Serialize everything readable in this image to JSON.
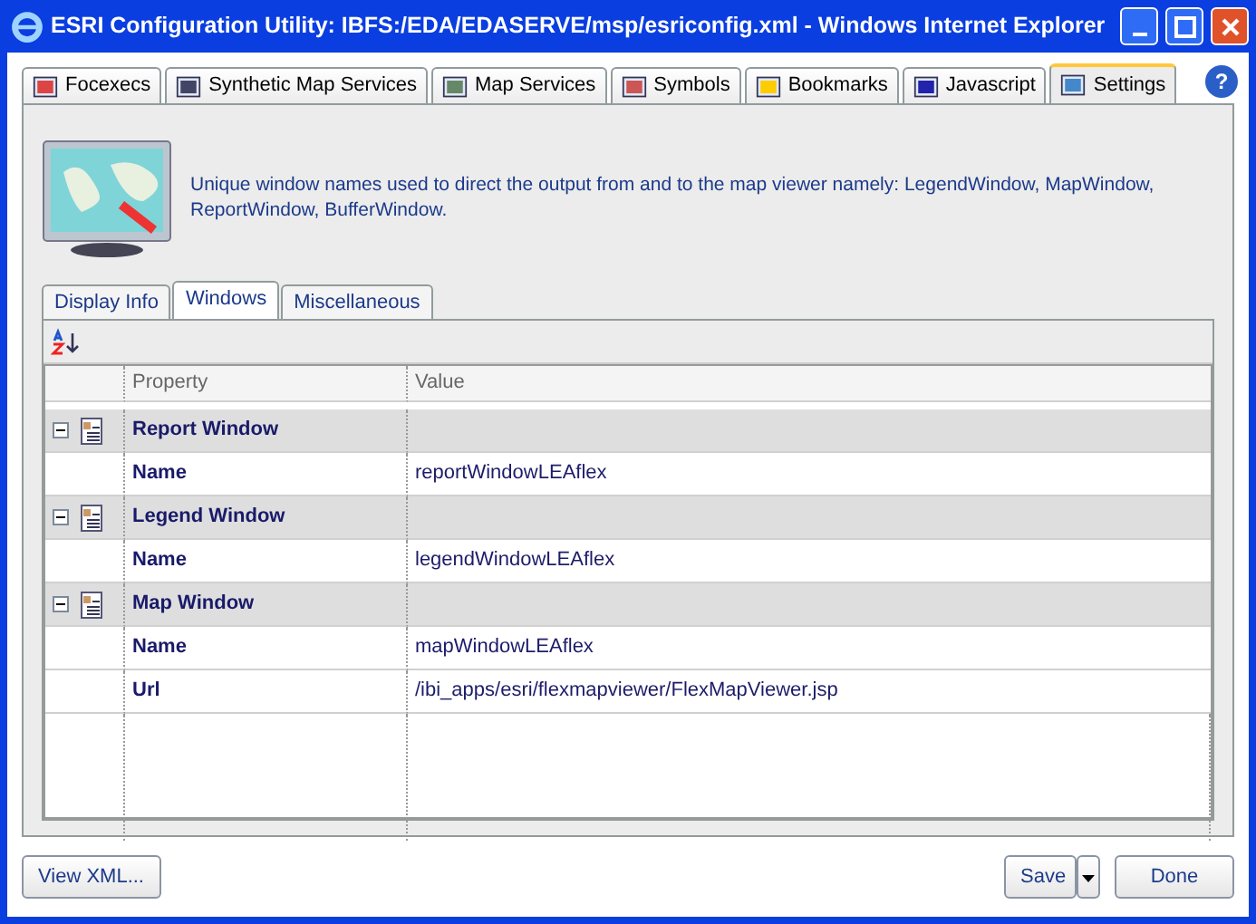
{
  "window": {
    "title": "ESRI Configuration Utility: IBFS:/EDA/EDASERVE/msp/esriconfig.xml - Windows Internet Explorer"
  },
  "tabs": [
    {
      "label": "Focexecs",
      "selected": false
    },
    {
      "label": "Synthetic Map Services",
      "selected": false
    },
    {
      "label": "Map Services",
      "selected": false
    },
    {
      "label": "Symbols",
      "selected": false
    },
    {
      "label": "Bookmarks",
      "selected": false
    },
    {
      "label": "Javascript",
      "selected": false
    },
    {
      "label": "Settings",
      "selected": true
    }
  ],
  "help": "?",
  "description": "Unique window names used to direct the output from and to the map viewer namely: LegendWindow, MapWindow, ReportWindow, BufferWindow.",
  "subtabs": [
    {
      "label": "Display Info",
      "selected": false
    },
    {
      "label": "Windows",
      "selected": true
    },
    {
      "label": "Miscellaneous",
      "selected": false
    }
  ],
  "grid": {
    "columns": [
      "Property",
      "Value"
    ],
    "groups": [
      {
        "label": "Report Window",
        "expanded": true,
        "rows": [
          {
            "property": "Name",
            "value": "reportWindowLEAflex"
          }
        ]
      },
      {
        "label": "Legend Window",
        "expanded": true,
        "rows": [
          {
            "property": "Name",
            "value": "legendWindowLEAflex"
          }
        ]
      },
      {
        "label": "Map Window",
        "expanded": true,
        "rows": [
          {
            "property": "Name",
            "value": "mapWindowLEAflex"
          },
          {
            "property": "Url",
            "value": "/ibi_apps/esri/flexmapviewer/FlexMapViewer.jsp"
          }
        ]
      }
    ]
  },
  "buttons": {
    "view_xml": "View XML...",
    "save": "Save",
    "done": "Done"
  }
}
